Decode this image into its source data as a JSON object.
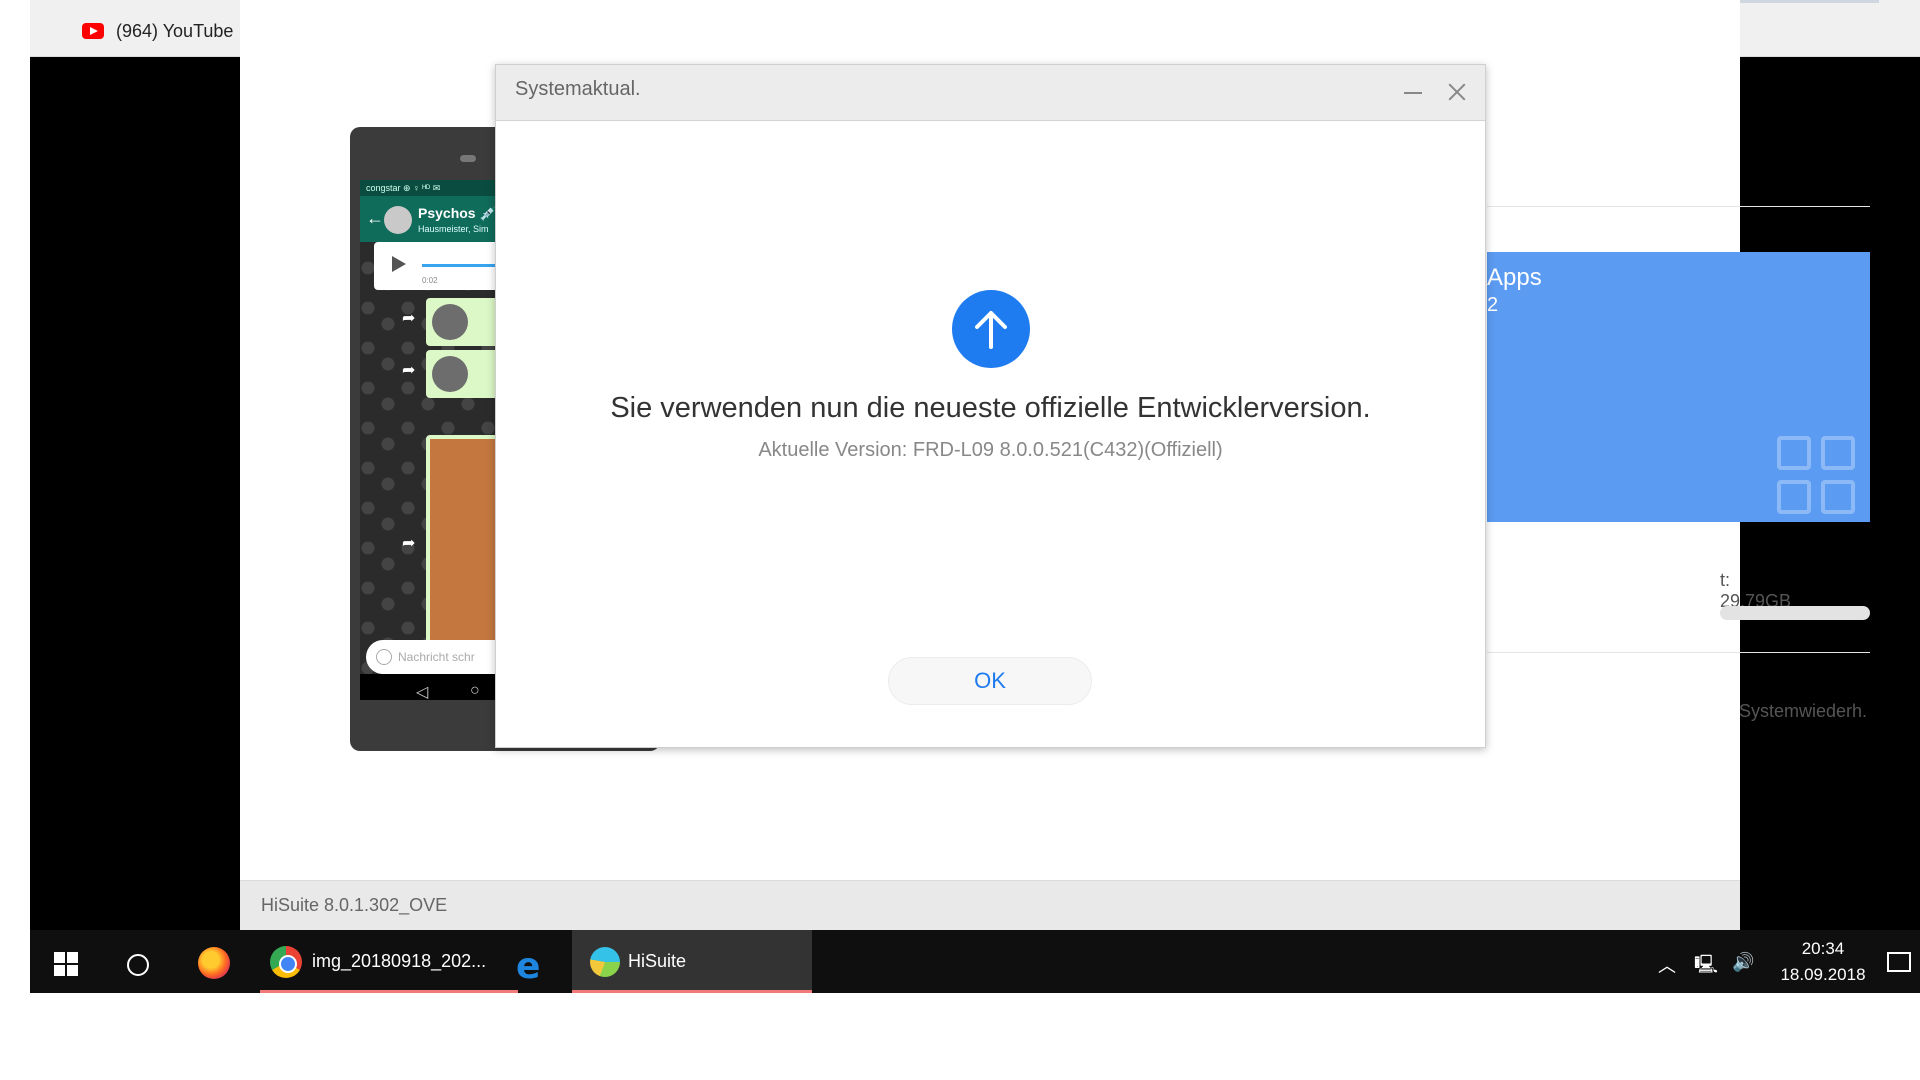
{
  "browser": {
    "tab_title": "(964) YouTube"
  },
  "hisuite": {
    "footer_version": "HiSuite 8.0.1.302_OVE",
    "apps_tile_title": "Apps",
    "apps_tile_count": "2",
    "storage_text": "t: 29.79GB",
    "restore_label": "Systemwiederh."
  },
  "phone": {
    "status_bar": "congstar ⊕ ♀ ᴴᴰ ✉",
    "chat_name": "Psychos 💉",
    "chat_subtitle": "Hausmeister, Sim",
    "voice_time": "0:02",
    "input_placeholder": "Nachricht schr"
  },
  "dialog": {
    "title": "Systemaktual.",
    "headline": "Sie verwenden nun die neueste offizielle Entwicklerversion.",
    "version_text": "Aktuelle Version: FRD-L09 8.0.0.521(C432)(Offiziell)",
    "ok_label": "OK",
    "accent_color": "#1e7bf0"
  },
  "taskbar": {
    "chrome_label": "img_20180918_202...",
    "hisuite_label": "HiSuite",
    "time": "20:34",
    "date": "18.09.2018"
  }
}
